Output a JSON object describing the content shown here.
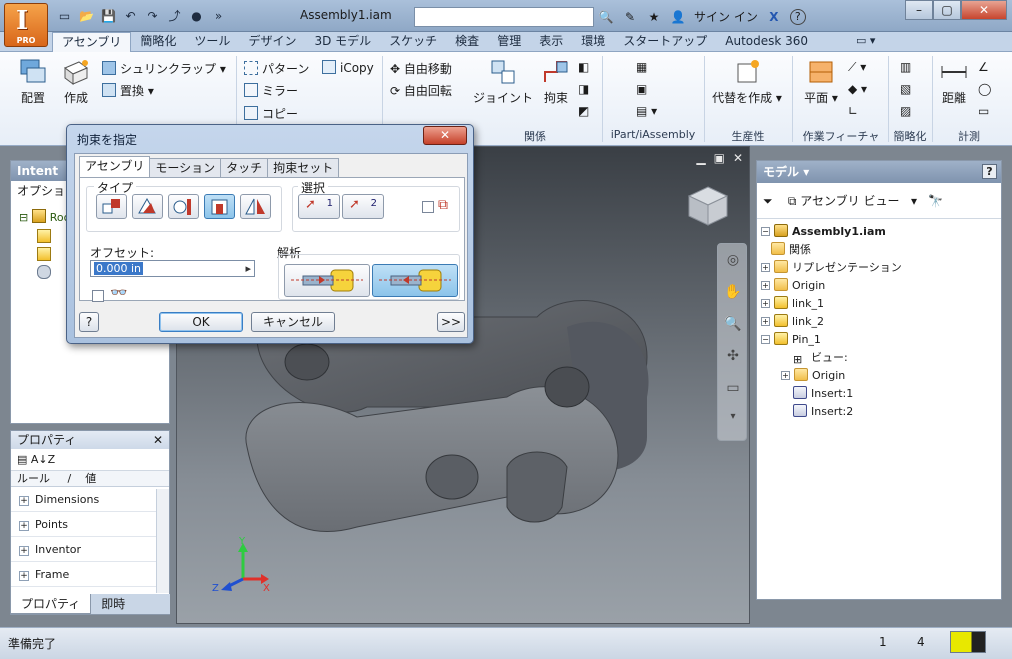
{
  "app": {
    "logo_letter": "I",
    "edition": "PRO",
    "document_title": "Assembly1.iam",
    "search_placeholder": "",
    "sign_in": "サイン イン",
    "help": "?"
  },
  "ribbon_tabs": [
    "アセンブリ",
    "簡略化",
    "ツール",
    "デザイン",
    "3D モデル",
    "スケッチ",
    "検査",
    "管理",
    "表示",
    "環境",
    "スタートアップ",
    "Autodesk 360"
  ],
  "ribbon": {
    "place": "配置",
    "create": "作成",
    "shrinkwrap": "シュリンクラップ",
    "replace": "置換",
    "pattern": "パターン",
    "mirror": "ミラー",
    "copy": "コピー",
    "icopy": "iCopy",
    "free_move": "自由移動",
    "free_rotate": "自由回転",
    "joint": "ジョイント",
    "constrain": "拘束",
    "substitute": "代替を作成",
    "plane": "平面",
    "distance": "距離",
    "group_relations": "関係",
    "group_ipart": "iPart/iAssembly",
    "group_productivity": "生産性",
    "group_work_features": "作業フィーチャ",
    "group_simplify": "簡略化",
    "group_measure": "計測"
  },
  "left_panel": {
    "title": "Intent",
    "subtitle": "オプショ",
    "root_node": "Roo"
  },
  "properties": {
    "title": "プロパティ",
    "col_rule": "ルール",
    "col_value": "値",
    "rows": [
      "Dimensions",
      "Points",
      "Inventor",
      "Frame"
    ],
    "tab_properties": "プロパティ",
    "tab_immediate": "即時"
  },
  "model_browser": {
    "title": "モデル",
    "view_label": "アセンブリ ビュー",
    "help": "?",
    "tree": [
      {
        "label": "Assembly1.iam",
        "bold": true
      },
      {
        "label": "関係"
      },
      {
        "label": "リプレゼンテーション"
      },
      {
        "label": "Origin"
      },
      {
        "label": "link_1"
      },
      {
        "label": "link_2"
      },
      {
        "label": "Pin_1"
      },
      {
        "label": "ビュー:"
      },
      {
        "label": "Origin"
      },
      {
        "label": "Insert:1"
      },
      {
        "label": "Insert:2"
      }
    ]
  },
  "dialog": {
    "title": "拘束を指定",
    "close": "X",
    "tabs": [
      "アセンブリ",
      "モーション",
      "タッチ",
      "拘束セット"
    ],
    "type_label": "タイプ",
    "select_label": "選択",
    "select1": "1",
    "select2": "2",
    "offset_label": "オフセット:",
    "offset_value": "0.000 in",
    "solution_label": "解析",
    "ok": "OK",
    "cancel": "キャンセル",
    "more": ">>",
    "help": "?"
  },
  "viewport": {
    "axis_x": "X",
    "axis_y": "Y",
    "axis_z": "Z"
  },
  "status": {
    "message": "準備完了",
    "count1": "1",
    "count2": "4"
  }
}
